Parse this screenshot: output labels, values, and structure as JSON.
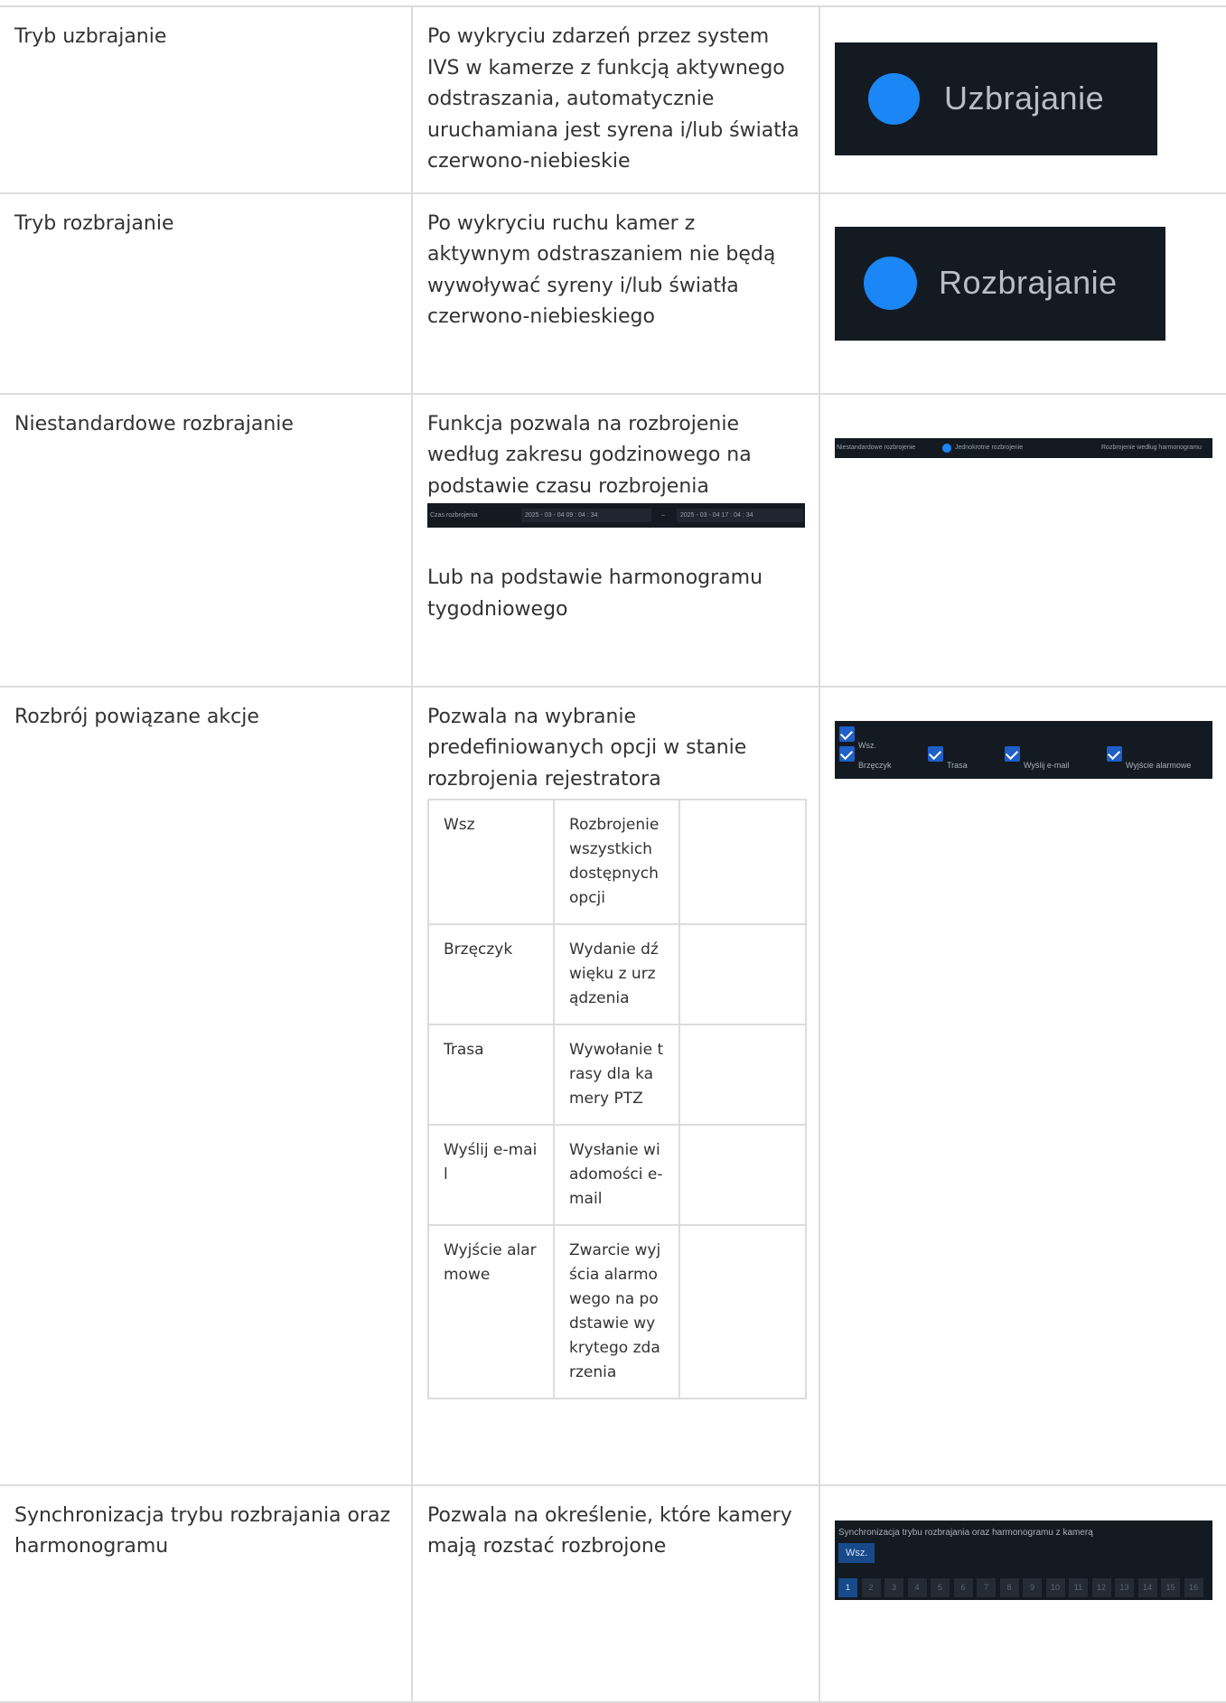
{
  "rows": [
    {
      "name": "Tryb uzbrajanie",
      "description": "Po wykryciu zdarzeń przez system IVS w kamerze z funkcją aktywnego odstraszania, automatycznie uruchamiana jest syrena i/lub światła czerwono-niebieskie",
      "panel_label": "Uzbrajanie"
    },
    {
      "name": "Tryb rozbrajanie",
      "description": "Po wykryciu ruchu kamer z aktywnym odstraszaniem nie będą wywoływać syreny i/lub światła czerwono-niebieskiego",
      "panel_label": "Rozbrajanie"
    },
    {
      "name": "Niestandardowe rozbrajanie",
      "description_1": "Funkcja pozwala na rozbrojenie według zakresu godzinowego na podstawie czasu rozbrojenia",
      "description_2": "Lub na podstawie harmonogramu tygodniowego",
      "time_bar": {
        "label": "Czas rozbrojenia",
        "start": "2025 - 03 - 04  09 : 04 : 34",
        "separator": "–",
        "end": "2025 - 03 - 04  17 : 04 : 34"
      },
      "options_bar": {
        "label": "Niestandardowe rozbrojenie",
        "option_1": "Jednokrotne rozbrojenie",
        "option_2": "Rozbrojenie według harmonogramu"
      }
    },
    {
      "name": "Rozbrój powiązane akcje",
      "description": "Pozwala na wybranie predefiniowanych opcji w stanie rozbrojenia rejestratora",
      "options": [
        {
          "label": "Wsz",
          "text": "Rozbrojenie wszystkich dostępnych opcji"
        },
        {
          "label": "Brzęczyk",
          "text": "Wydanie dźwięku z urządzenia"
        },
        {
          "label": "Trasa",
          "text": "Wywołanie trasy dla kamery PTZ"
        },
        {
          "label": "Wyślij e-mail",
          "text": "Wysłanie wiadomości e-mail"
        },
        {
          "label": "Wyjście alarmowe",
          "text": "Zwarcie wyjścia alarmowego na podstawie wykrytego zdarzenia"
        }
      ],
      "panel": {
        "all": "Wsz.",
        "buzzer": "Brzęczyk",
        "route": "Trasa",
        "email": "Wyślij e-mail",
        "alarm_out": "Wyjście alarmowe"
      }
    },
    {
      "name": "Synchronizacja trybu rozbrajania oraz harmonogramu",
      "description": "Pozwala na określenie, które kamery mają rozstać rozbrojone",
      "panel": {
        "title": "Synchronizacja trybu rozbrajania oraz harmonogramu z kamerą",
        "all_button": "Wsz.",
        "channels": [
          "1",
          "2",
          "3",
          "4",
          "5",
          "6",
          "7",
          "8",
          "9",
          "10",
          "11",
          "12",
          "13",
          "14",
          "15",
          "16"
        ]
      }
    }
  ],
  "colors": {
    "panel_bg": "#141a22",
    "accent_blue": "#1b86f5",
    "border": "#dcdcdc",
    "text": "#333333"
  }
}
